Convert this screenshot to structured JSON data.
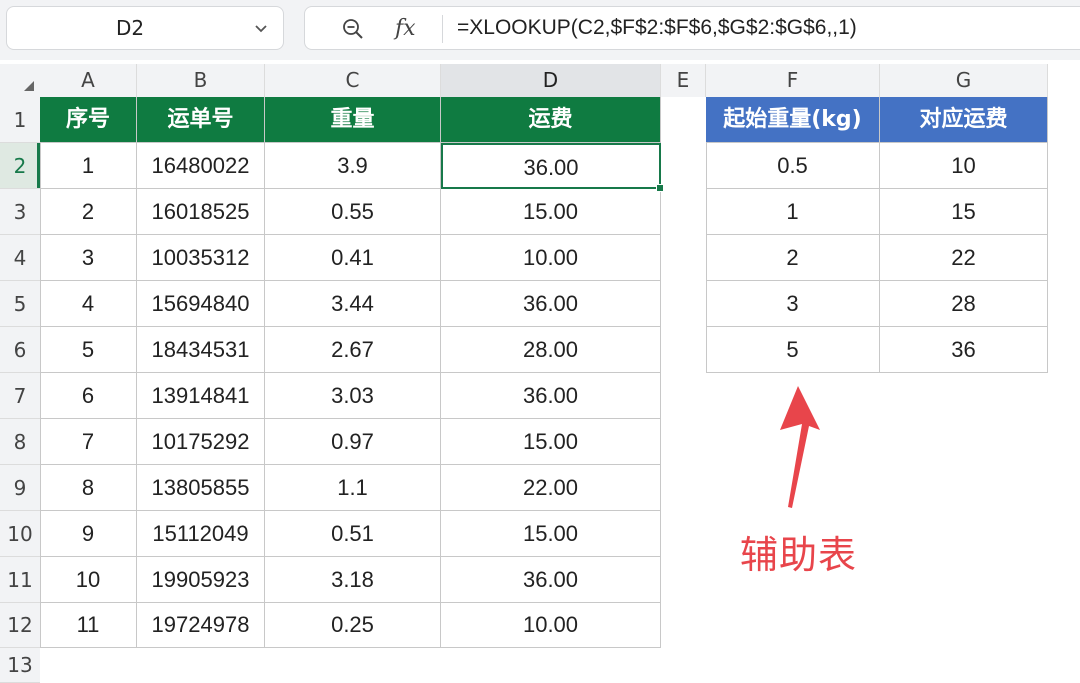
{
  "formula_bar": {
    "name_box": "D2",
    "fx_label": "fx",
    "formula": "=XLOOKUP(C2,$F$2:$F$6,$G$2:$G$6,,1)"
  },
  "grid": {
    "columns": [
      "A",
      "B",
      "C",
      "D",
      "E",
      "F",
      "G"
    ],
    "active_column": "D",
    "rows": [
      "1",
      "2",
      "3",
      "4",
      "5",
      "6",
      "7",
      "8",
      "9",
      "10",
      "11",
      "12",
      "13"
    ],
    "active_row": "2",
    "selected_cell": "D2"
  },
  "main_table": {
    "headers": [
      "序号",
      "运单号",
      "重量",
      "运费"
    ],
    "rows": [
      [
        "1",
        "16480022",
        "3.9",
        "36.00"
      ],
      [
        "2",
        "16018525",
        "0.55",
        "15.00"
      ],
      [
        "3",
        "10035312",
        "0.41",
        "10.00"
      ],
      [
        "4",
        "15694840",
        "3.44",
        "36.00"
      ],
      [
        "5",
        "18434531",
        "2.67",
        "28.00"
      ],
      [
        "6",
        "13914841",
        "3.03",
        "36.00"
      ],
      [
        "7",
        "10175292",
        "0.97",
        "15.00"
      ],
      [
        "8",
        "13805855",
        "1.1",
        "22.00"
      ],
      [
        "9",
        "15112049",
        "0.51",
        "15.00"
      ],
      [
        "10",
        "19905923",
        "3.18",
        "36.00"
      ],
      [
        "11",
        "19724978",
        "0.25",
        "10.00"
      ]
    ]
  },
  "aux_table": {
    "headers": [
      "起始重量(kg)",
      "对应运费"
    ],
    "rows": [
      [
        "0.5",
        "10"
      ],
      [
        "1",
        "15"
      ],
      [
        "2",
        "22"
      ],
      [
        "3",
        "28"
      ],
      [
        "5",
        "36"
      ]
    ]
  },
  "annotation": {
    "label": "辅助表"
  },
  "colors": {
    "main_header_bg": "#0f7b41",
    "aux_header_bg": "#4472c4",
    "annotation": "#e8454b",
    "selection": "#17794a"
  }
}
